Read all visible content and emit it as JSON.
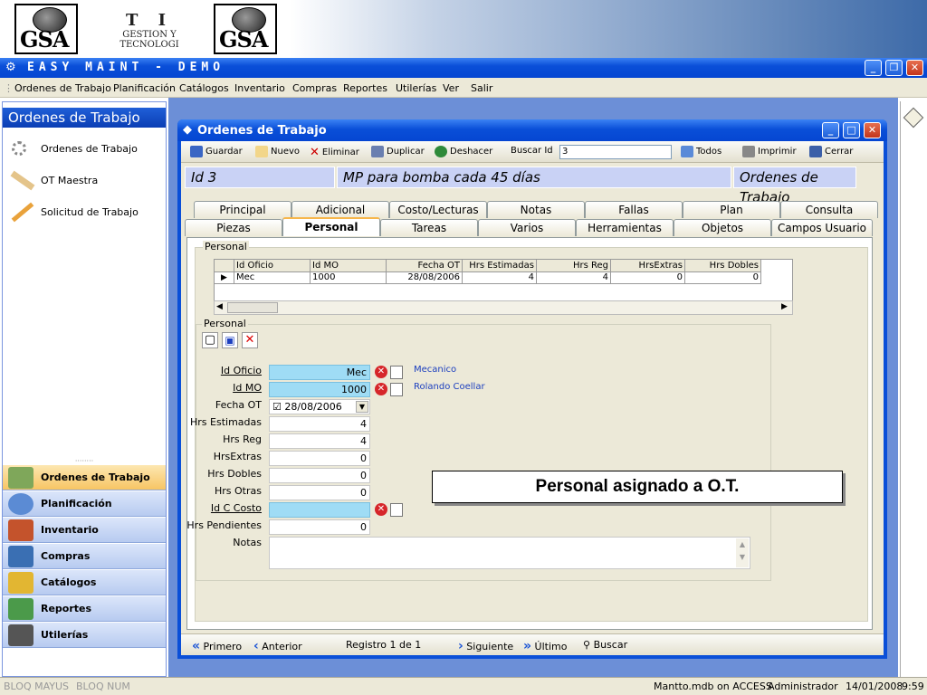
{
  "banner": {
    "logo_text": "GSA",
    "ti_line1": "T I",
    "ti_line2": "GESTION Y",
    "ti_line3": "TECNOLOGI"
  },
  "app": {
    "title": "EASY MAINT - DEMO"
  },
  "menu": [
    "Ordenes de Trabajo",
    "Planificación",
    "Catálogos",
    "Inventario",
    "Compras",
    "Reportes",
    "Utilerías",
    "Ver",
    "Salir"
  ],
  "left_panel": {
    "title": "Ordenes de Trabajo",
    "items": [
      "Ordenes de Trabajo",
      "OT Maestra",
      "Solicitud de Trabajo"
    ],
    "nav": [
      {
        "label": "Ordenes de Trabajo",
        "color": "#7fa75a"
      },
      {
        "label": "Planificación",
        "color": "#5b8bd4"
      },
      {
        "label": "Inventario",
        "color": "#c4532c"
      },
      {
        "label": "Compras",
        "color": "#3a6fb3"
      },
      {
        "label": "Catálogos",
        "color": "#e2b632"
      },
      {
        "label": "Reportes",
        "color": "#4b9a4a"
      },
      {
        "label": "Utilerías",
        "color": "#555"
      }
    ]
  },
  "form": {
    "title": "Ordenes de Trabajo",
    "toolbar": {
      "guardar": "Guardar",
      "nuevo": "Nuevo",
      "eliminar": "Eliminar",
      "duplicar": "Duplicar",
      "deshacer": "Deshacer",
      "buscar_label": "Buscar Id",
      "buscar_value": "3",
      "todos": "Todos",
      "imprimir": "Imprimir",
      "cerrar": "Cerrar"
    },
    "header": {
      "id": "Id  3",
      "description": "MP para bomba cada 45 días",
      "module": "Ordenes de Trabajo"
    },
    "tabs_row1": [
      "Principal",
      "Adicional",
      "Costo/Lecturas",
      "Notas",
      "Fallas",
      "Plan",
      "Consulta"
    ],
    "tabs_row2": [
      "Piezas",
      "Personal",
      "Tareas",
      "Varios",
      "Herramientas",
      "Objetos",
      "Campos Usuario"
    ],
    "selected_tab": "Personal",
    "section_label": "Personal",
    "grid": {
      "columns": [
        "Id Oficio",
        "Id MO",
        "Fecha OT",
        "Hrs Estimadas",
        "Hrs Reg",
        "HrsExtras",
        "Hrs Dobles"
      ],
      "rows": [
        [
          "Mec",
          "1000",
          "28/08/2006",
          "4",
          "4",
          "0",
          "0"
        ]
      ]
    },
    "detail_label": "Personal",
    "fields": {
      "id_oficio_label": "Id Oficio",
      "id_oficio": "Mec",
      "id_oficio_desc": "Mecanico",
      "id_mo_label": "Id MO",
      "id_mo": "1000",
      "id_mo_desc": "Rolando Coellar",
      "fecha_ot_label": "Fecha OT",
      "fecha_ot": "28/08/2006",
      "hrs_estimadas_label": "Hrs Estimadas",
      "hrs_estimadas": "4",
      "hrs_reg_label": "Hrs Reg",
      "hrs_reg": "4",
      "hrs_extras_label": "HrsExtras",
      "hrs_extras": "0",
      "hrs_dobles_label": "Hrs Dobles",
      "hrs_dobles": "0",
      "hrs_otras_label": "Hrs Otras",
      "hrs_otras": "0",
      "id_c_costo_label": "Id C Costo",
      "id_c_costo": "",
      "hrs_pendientes_label": "Hrs Pendientes",
      "hrs_pendientes": "0",
      "notas_label": "Notas",
      "notas": ""
    },
    "nav": {
      "primero": "Primero",
      "anterior": "Anterior",
      "registro": "Registro 1 de 1",
      "siguiente": "Siguiente",
      "ultimo": "Último",
      "buscar": "Buscar"
    }
  },
  "callout": "Personal asignado a O.T.",
  "status": {
    "caps": "BLOQ MAYUS",
    "num": "BLOQ NUM",
    "db": "Mantto.mdb on ACCESS",
    "user": "Administrador",
    "date": "14/01/2008",
    "time": "9:59"
  }
}
